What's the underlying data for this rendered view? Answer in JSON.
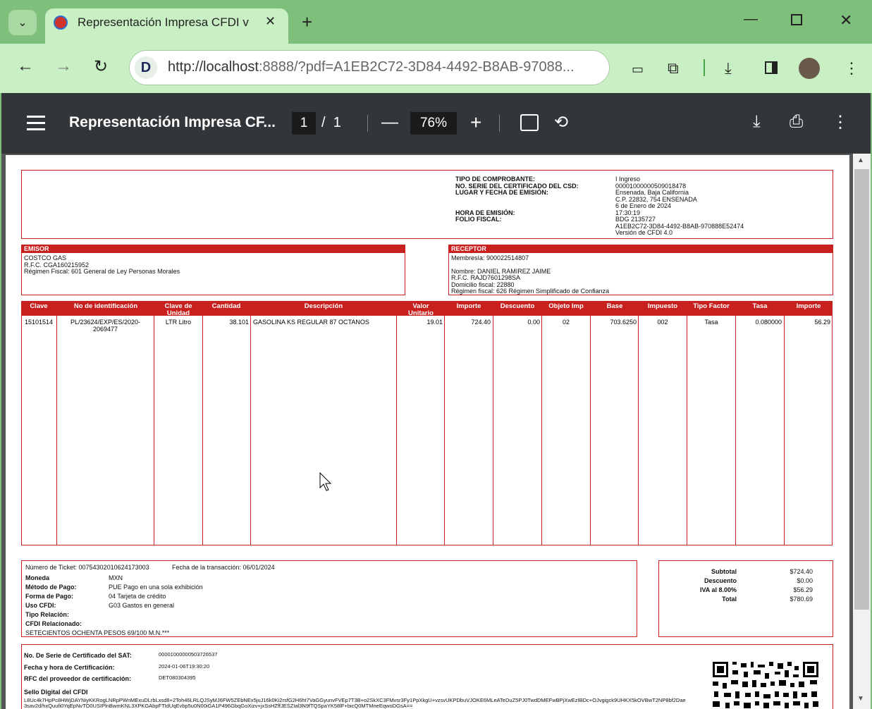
{
  "browser": {
    "tab_title": "Representación Impresa CFDI v",
    "url_host": "http://localhost",
    "url_rest": ":8888/?pdf=A1EB2C72-3D84-4492-B8AB-97088...",
    "site_initial": "D"
  },
  "viewer": {
    "title": "Representación Impresa CF...",
    "page_current": "1",
    "page_sep": "/",
    "page_total": "1",
    "zoom": "76%"
  },
  "invoice": {
    "header_fields": [
      {
        "label": "TIPO DE COMPROBANTE:",
        "value": "I Ingreso"
      },
      {
        "label": "NO. SERIE DEL CERTIFICADO DEL CSD:",
        "value": "00001000000509018478"
      },
      {
        "label": "LUGAR Y FECHA DE EMISIÓN:",
        "value": "Ensenada, Baja California"
      }
    ],
    "lugar_extra": [
      "C.P. 22832, 754 ENSENADA",
      "6 de Enero de 2024"
    ],
    "hora_label": "HORA DE EMISIÓN:",
    "hora_value": "17:30:19",
    "folio_label": "FOLIO FISCAL:",
    "folio_values": [
      "BDG 2135727",
      "A1EB2C72-3D84-4492-B8AB-970888E52474",
      "Versión de CFDI 4.0"
    ],
    "emisor": {
      "title": "EMISOR",
      "lines": [
        "COSTCO GAS",
        "R.F.C. CGA160215952",
        "Régimen Fiscal: 601 General de Ley Personas Morales"
      ]
    },
    "receptor": {
      "title": "RECEPTOR",
      "lines": [
        "Membresía: 900022514807",
        "",
        "Nombre: DANIEL RAMIREZ JAIME",
        "R.F.C. RAJD7601298SA",
        "Domicilio fiscal: 22880",
        "Régimen fiscal: 626 Régimen Simplificado de Confianza"
      ]
    },
    "columns": [
      "Clave",
      "No de identificación",
      "Clave de Unidad",
      "Cantidad",
      "Descripción",
      "Valor Unitario",
      "Importe",
      "Descuento",
      "Objeto Imp",
      "Base",
      "Impuesto",
      "Tipo Factor",
      "Tasa",
      "Importe"
    ],
    "row": {
      "clave": "15101514",
      "no_ident": "PL/23624/EXP/ES/2020-2069477",
      "clave_unidad": "LTR Litro",
      "cantidad": "38.101",
      "descripcion": "GASOLINA KS REGULAR 87 OCTANOS",
      "valor_unitario": "19.01",
      "importe": "724.40",
      "descuento": "0.00",
      "objeto_imp": "02",
      "base": "703.6250",
      "impuesto": "002",
      "tipo_factor": "Tasa",
      "tasa": "0.080000",
      "importe_imp": "56.29"
    },
    "ticket_line": "Número de Ticket: 00754302010624173003",
    "fecha_trans": "Fecha de la transacción: 06/01/2024",
    "payment": [
      {
        "label": "Moneda",
        "value": "MXN"
      },
      {
        "label": "Método de Pago:",
        "value": "PUE Pago en una sola exhibición"
      },
      {
        "label": "Forma de Pago:",
        "value": "04 Tarjeta de crédito"
      },
      {
        "label": "Uso CFDI:",
        "value": "G03 Gastos en general"
      },
      {
        "label": "Tipo Relación:",
        "value": ""
      },
      {
        "label": "CFDI Relacionado:",
        "value": ""
      }
    ],
    "amount_words": "SETECIENTOS OCHENTA PESOS 69/100 M.N.***",
    "totals": [
      {
        "label": "Subtotal",
        "value": "$724.40"
      },
      {
        "label": "Descuento",
        "value": "$0.00"
      },
      {
        "label": "IVA al 8.00%",
        "value": "$56.29"
      },
      {
        "label": "Total",
        "value": "$780.69"
      }
    ],
    "cert": [
      {
        "label": "No. De Serie de Certificado del SAT:",
        "value": "00001000000503726537"
      },
      {
        "label": "Fecha y hora de Certificación:",
        "value": "2024-01-06T19:30:20"
      },
      {
        "label": "RFC del proveedor de certificación:",
        "value": "DET080304395"
      }
    ],
    "sello_label": "Sello Digital del CFDI",
    "sello_value": "L8Uc4k7HpPc8HWjDAYNiyKKRogLNRpPWnMExuDLrbLxsd8+2Toh46LRLQJSyMJ6FW5ZEbNEx5juJ16k0Ki2rsfG2H6ht7VaGGyunvFVEp7T3B+o2SkXC3FMvsr3Fy1PpXkgU+vzsvUKPDbuVJOKE6MLeATeDuZ5PJ0TwdDMEFwBPjXwEzIBDc+OJvgigck9UHKX5kOVBwT2NP8bf2Dae",
    "sello_value2": "3sav2d/hxQuufi0YqEpNvTO0USIPlnBwmKNL3XPKGAbpFTIdUqEvbp5u0N00iGA1P496GbqGoXizv+jxSsHZffJESZIal3N9fTQSpaYK58lF+bicQ0MTMneEqwoDGsA=="
  }
}
